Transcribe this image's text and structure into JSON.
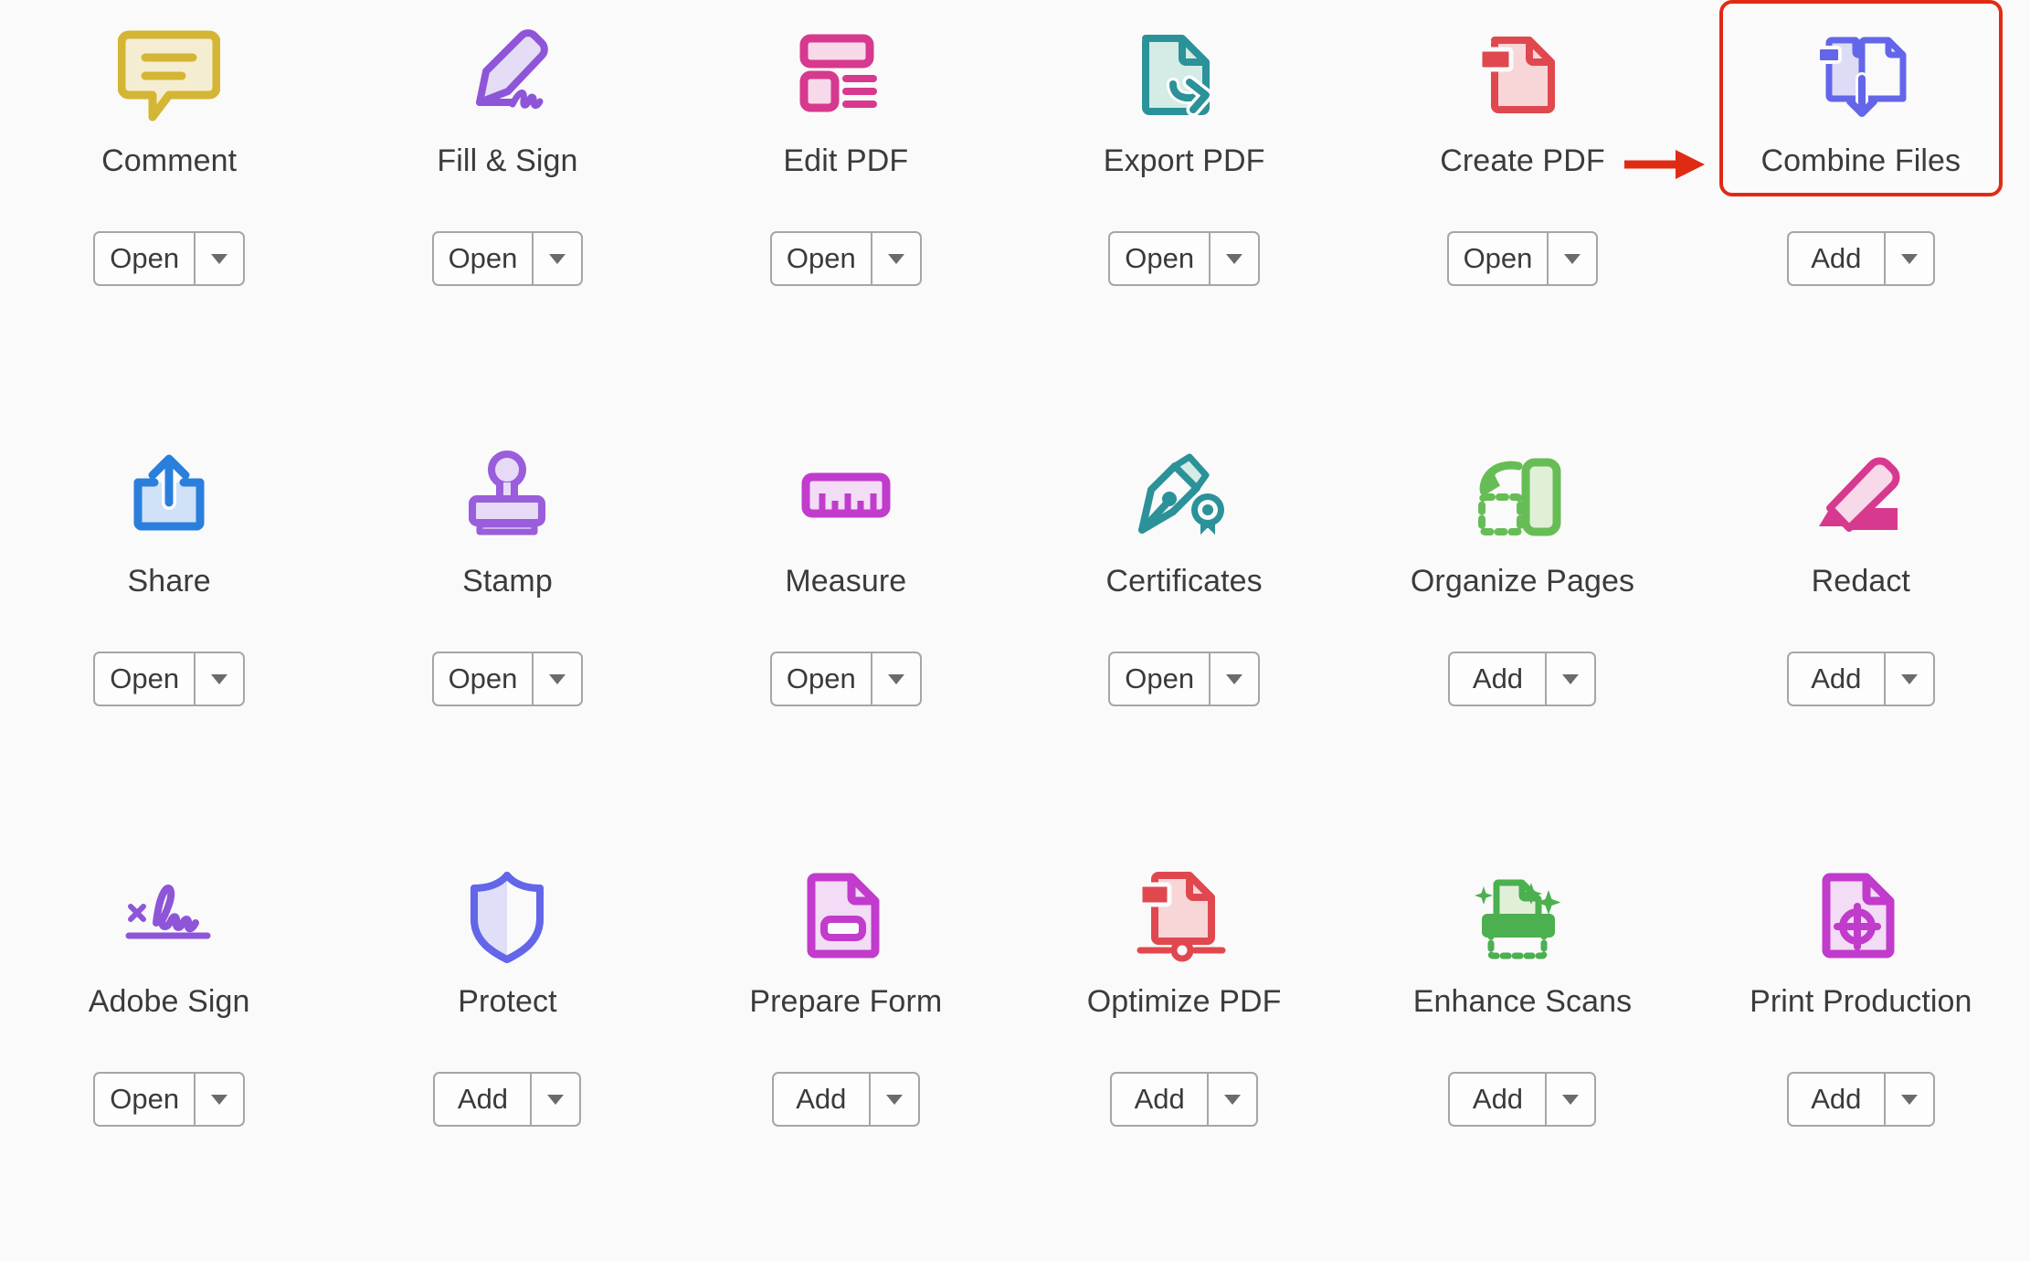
{
  "app": {
    "accent_highlight_color": "#e02b14",
    "background_color": "#fafafa",
    "label_color": "#3b3b3b"
  },
  "annotation": {
    "arrow": {
      "name": "red-pointer-arrow",
      "color": "#e02b14",
      "points_to": "Combine Files"
    },
    "highlight_box": {
      "name": "red-highlight-box",
      "color": "#e02b14",
      "around": "Combine Files"
    }
  },
  "tools": [
    {
      "label": "Comment",
      "icon": "comment-bubble-icon",
      "icon_color": "#d4b634",
      "icon_fill": "#f5edd2",
      "action": "Open",
      "highlighted": false
    },
    {
      "label": "Fill & Sign",
      "icon": "pencil-signature-icon",
      "icon_color": "#8e55d8",
      "icon_fill": "#e5dcf5",
      "action": "Open",
      "highlighted": false
    },
    {
      "label": "Edit PDF",
      "icon": "edit-layout-icon",
      "icon_color": "#d7398f",
      "icon_fill": "#f7d9ea",
      "action": "Open",
      "highlighted": false
    },
    {
      "label": "Export PDF",
      "icon": "export-document-arrow-icon",
      "icon_color": "#2a9298",
      "icon_fill": "#d4ebe6",
      "action": "Open",
      "highlighted": false
    },
    {
      "label": "Create PDF",
      "icon": "create-document-icon",
      "icon_color": "#e0484f",
      "icon_fill": "#f8d6d8",
      "action": "Open",
      "highlighted": false
    },
    {
      "label": "Combine Files",
      "icon": "combine-files-icon",
      "icon_color": "#6366e8",
      "icon_fill": "#dcdcf7",
      "action": "Add",
      "highlighted": true
    },
    {
      "label": "Share",
      "icon": "share-upload-icon",
      "icon_color": "#2b7fdc",
      "icon_fill": "#cfe2f8",
      "action": "Open",
      "highlighted": false
    },
    {
      "label": "Stamp",
      "icon": "stamp-icon",
      "icon_color": "#9a5ddb",
      "icon_fill": "#e6daf7",
      "action": "Open",
      "highlighted": false
    },
    {
      "label": "Measure",
      "icon": "ruler-icon",
      "icon_color": "#c13bcc",
      "icon_fill": "#f3dcf5",
      "action": "Open",
      "highlighted": false
    },
    {
      "label": "Certificates",
      "icon": "fountain-pen-seal-icon",
      "icon_color": "#2a9298",
      "icon_fill": "#d4ebe6",
      "action": "Open",
      "highlighted": false
    },
    {
      "label": "Organize Pages",
      "icon": "organize-pages-rotate-icon",
      "icon_color": "#67bd55",
      "icon_fill": "#e0f0d8",
      "action": "Add",
      "highlighted": false
    },
    {
      "label": "Redact",
      "icon": "redact-marker-icon",
      "icon_color": "#d7398f",
      "icon_fill": "#f7d9ea",
      "action": "Add",
      "highlighted": false
    },
    {
      "label": "Adobe Sign",
      "icon": "adobe-sign-signature-icon",
      "icon_color": "#8e55d8",
      "icon_fill": "#e5dcf5",
      "action": "Open",
      "highlighted": false
    },
    {
      "label": "Protect",
      "icon": "shield-icon",
      "icon_color": "#6366e8",
      "icon_fill": "#dfdff8",
      "action": "Add",
      "highlighted": false
    },
    {
      "label": "Prepare Form",
      "icon": "prepare-form-icon",
      "icon_color": "#c13bcc",
      "icon_fill": "#f3dcf5",
      "action": "Add",
      "highlighted": false
    },
    {
      "label": "Optimize PDF",
      "icon": "optimize-pdf-slider-icon",
      "icon_color": "#e0484f",
      "icon_fill": "#f8d6d8",
      "action": "Add",
      "highlighted": false
    },
    {
      "label": "Enhance Scans",
      "icon": "scanner-sparkle-icon",
      "icon_color": "#4caf50",
      "icon_fill": "#e0f0d8",
      "action": "Add",
      "highlighted": false
    },
    {
      "label": "Print Production",
      "icon": "print-production-target-icon",
      "icon_color": "#c13bcc",
      "icon_fill": "#f3dcf5",
      "action": "Add",
      "highlighted": false
    }
  ]
}
